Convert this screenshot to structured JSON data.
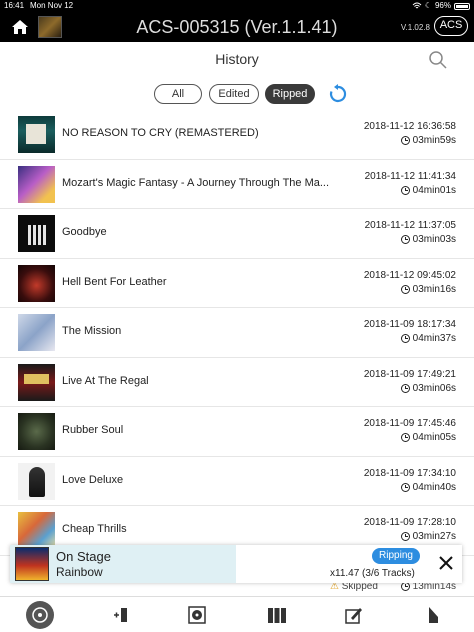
{
  "status_bar": {
    "time": "16:41",
    "date": "Mon Nov 12",
    "battery": "96%"
  },
  "title_bar": {
    "title": "ACS-005315 (Ver.1.1.41)",
    "version": "V.1.02.8",
    "acs_button": "ACS"
  },
  "header": {
    "title": "History"
  },
  "filters": [
    {
      "label": "All",
      "active": false
    },
    {
      "label": "Edited",
      "active": false
    },
    {
      "label": "Ripped",
      "active": true
    }
  ],
  "history": [
    {
      "title": "NO REASON TO CRY (REMASTERED)",
      "timestamp": "2018-11-12 16:36:58",
      "duration": "03min59s"
    },
    {
      "title": "Mozart's Magic Fantasy - A Journey Through The Ma...",
      "timestamp": "2018-11-12 11:41:34",
      "duration": "04min01s"
    },
    {
      "title": "Goodbye",
      "timestamp": "2018-11-12 11:37:05",
      "duration": "03min03s"
    },
    {
      "title": "Hell Bent For Leather",
      "timestamp": "2018-11-12 09:45:02",
      "duration": "03min16s"
    },
    {
      "title": "The Mission",
      "timestamp": "2018-11-09 18:17:34",
      "duration": "04min37s"
    },
    {
      "title": "Live At The Regal",
      "timestamp": "2018-11-09 17:49:21",
      "duration": "03min06s"
    },
    {
      "title": "Rubber Soul",
      "timestamp": "2018-11-09 17:45:46",
      "duration": "04min05s"
    },
    {
      "title": "Love Deluxe",
      "timestamp": "2018-11-09 17:34:10",
      "duration": "04min40s"
    },
    {
      "title": "Cheap Thrills",
      "timestamp": "2018-11-09 17:28:10",
      "duration": "03min27s"
    }
  ],
  "now_playing": {
    "album": "On Stage",
    "artist": "Rainbow",
    "status": "Ripping",
    "progress_text": "x11.47 (3/6 Tracks)",
    "progress_fraction": 0.5
  },
  "partial_row": {
    "status": "Skipped",
    "duration": "13min14s"
  },
  "tabs": [
    "history-icon",
    "ripping-icon",
    "cd-icon",
    "library-icon",
    "edit-icon",
    "settings-icon"
  ]
}
